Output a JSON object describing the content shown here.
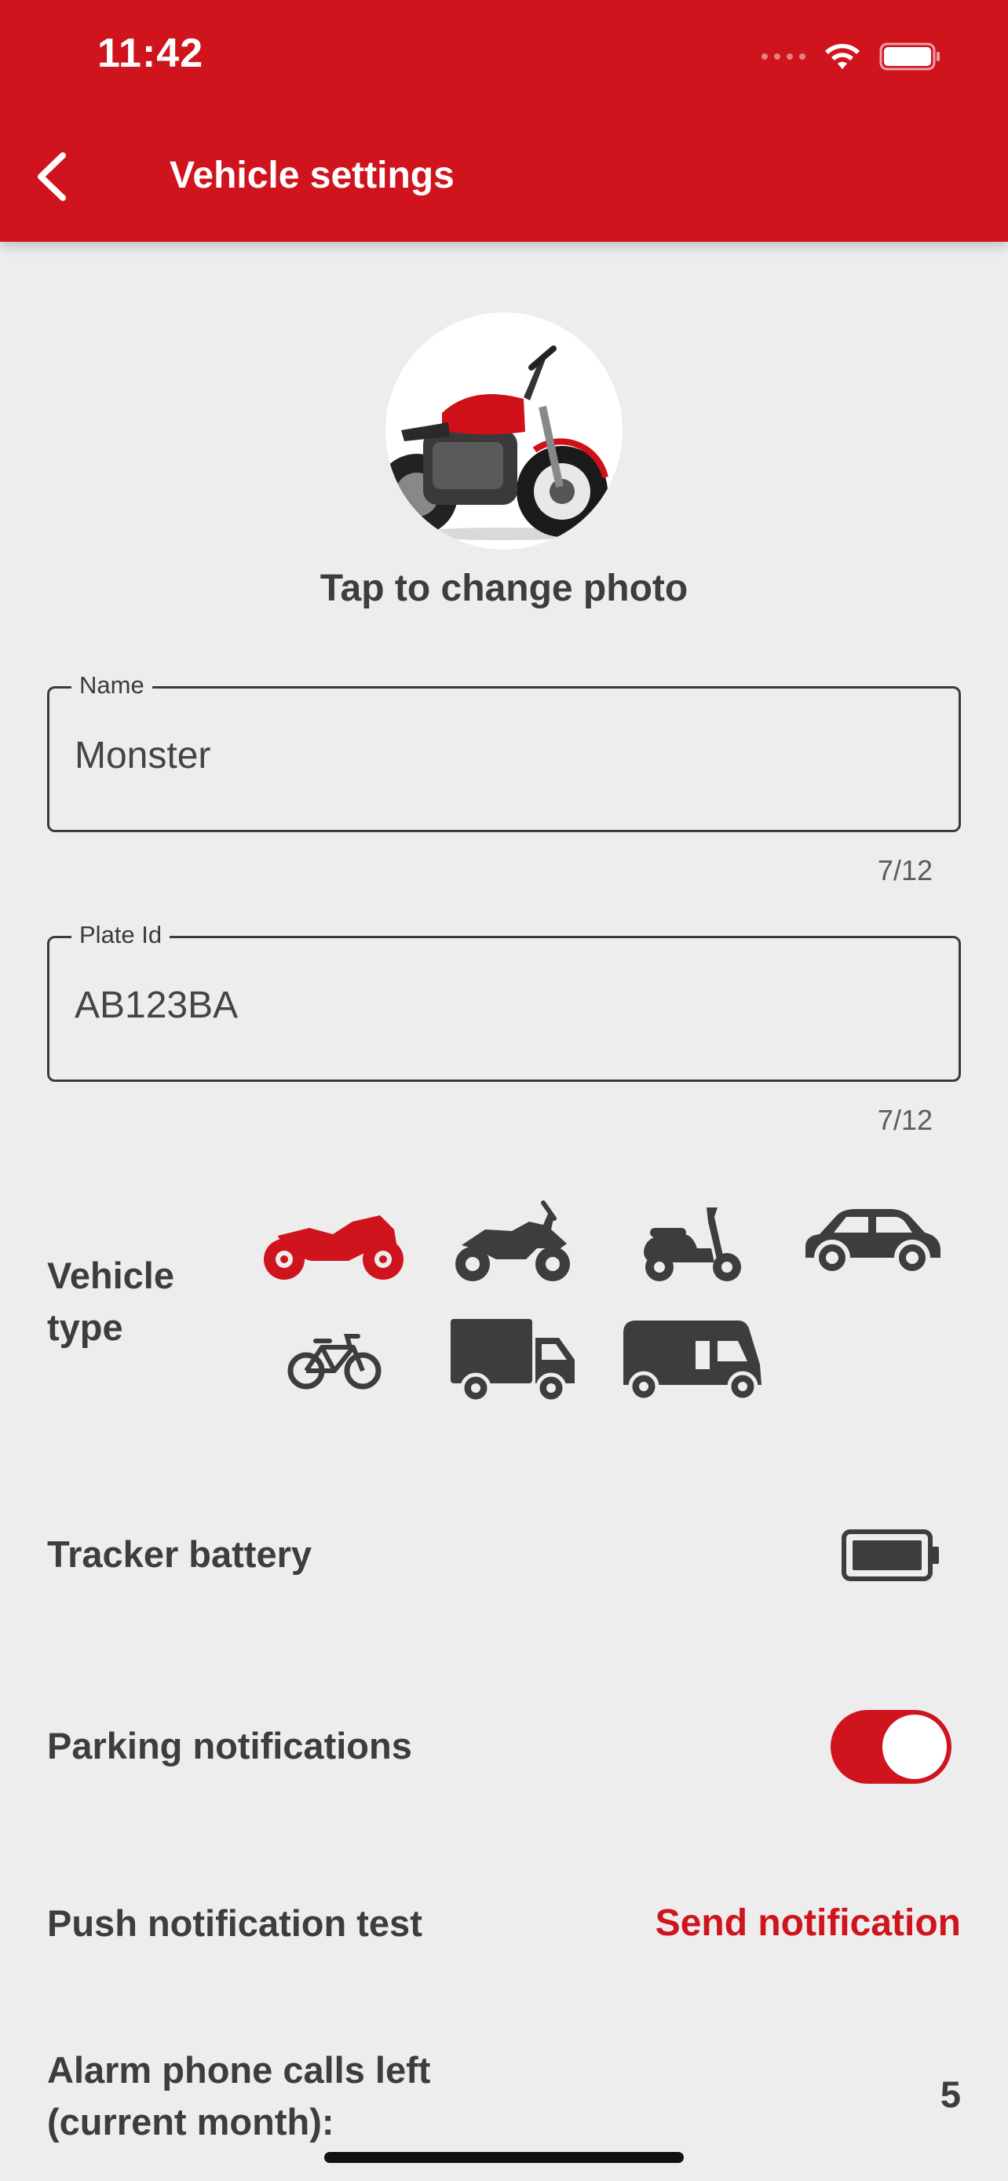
{
  "status_bar": {
    "time": "11:42"
  },
  "header": {
    "title": "Vehicle settings",
    "back_icon": "chevron-left-icon",
    "bg_color": "#cf141e"
  },
  "photo": {
    "caption": "Tap to change photo"
  },
  "fields": {
    "name": {
      "label": "Name",
      "value": "Monster",
      "counter": "7/12"
    },
    "plate": {
      "label": "Plate Id",
      "value": "AB123BA",
      "counter": "7/12"
    }
  },
  "vehicle_type": {
    "label": "Vehicle type",
    "options": [
      "sport-motorbike",
      "adventure-motorbike",
      "scooter",
      "car",
      "bicycle",
      "truck",
      "camper"
    ],
    "selected": "sport-motorbike",
    "selected_color": "#cf141e",
    "icon_color": "#3d3d3f"
  },
  "tracker_battery": {
    "label": "Tracker battery",
    "icon": "battery-full-icon"
  },
  "parking_notifications": {
    "label": "Parking notifications",
    "enabled": true
  },
  "push_test": {
    "label": "Push notification test",
    "action": "Send notification"
  },
  "alarm_calls": {
    "label": "Alarm phone calls left (current month):",
    "value": "5"
  }
}
